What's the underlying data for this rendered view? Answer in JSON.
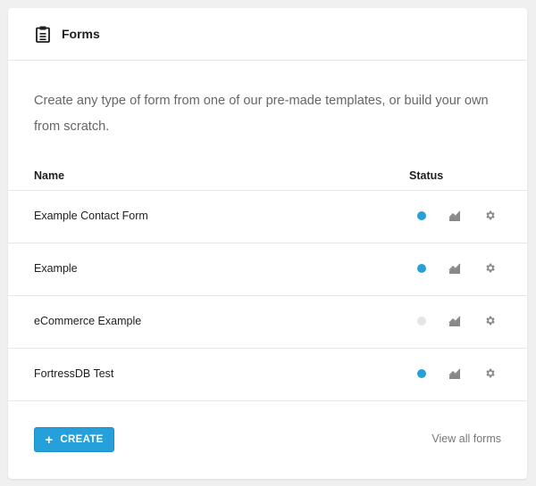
{
  "header": {
    "icon": "clipboard-icon",
    "title": "Forms"
  },
  "description": "Create any type of form from one of our pre-made templates, or build your own from scratch.",
  "table": {
    "columns": [
      "Name",
      "Status"
    ],
    "rows": [
      {
        "name": "Example Contact Form",
        "status_color": "#26a0da",
        "active": true
      },
      {
        "name": "Example",
        "status_color": "#26a0da",
        "active": true
      },
      {
        "name": "eCommerce Example",
        "status_color": "#e5e5e5",
        "active": false
      },
      {
        "name": "FortressDB Test",
        "status_color": "#26a0da",
        "active": true
      }
    ],
    "row_icons": [
      "stats-icon",
      "gear-icon"
    ]
  },
  "footer": {
    "create_label": "CREATE",
    "create_icon": "plus-icon",
    "view_all_label": "View all forms"
  },
  "colors": {
    "accent": "#26a0da",
    "inactive": "#e5e5e5",
    "icon_gray": "#888888"
  }
}
